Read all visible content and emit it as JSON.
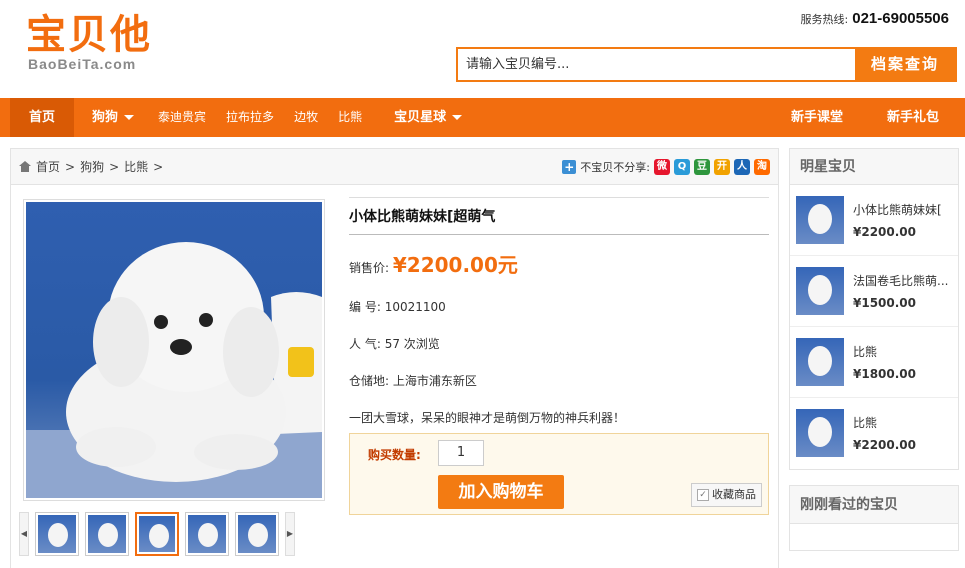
{
  "header": {
    "logo_main": "宝贝他",
    "logo_sub": "BaoBeiTa.com",
    "hotline_label": "服务热线:",
    "hotline_number": "021-69005506",
    "search_placeholder": "请输入宝贝编号...",
    "search_button": "档案查询"
  },
  "nav": {
    "items": [
      "首页",
      "狗狗",
      "泰迪贵宾",
      "拉布拉多",
      "边牧",
      "比熊",
      "宝贝星球"
    ],
    "right_items": [
      "新手课堂",
      "新手礼包"
    ]
  },
  "breadcrumb": [
    "首页",
    "狗狗",
    "比熊"
  ],
  "share": {
    "label": "不宝贝不分享:",
    "icons": [
      "weibo",
      "qzone",
      "douban",
      "kaixin",
      "renren",
      "taobao"
    ],
    "icon_glyphs": [
      "微",
      "Q",
      "豆",
      "开",
      "人",
      "淘"
    ],
    "icon_colors": [
      "#e6162d",
      "#2a9bd8",
      "#2e963d",
      "#f1a200",
      "#1d67b6",
      "#ff6a00"
    ]
  },
  "product": {
    "title": "小体比熊萌妹妹[超萌气",
    "price_label": "销售价:",
    "price": "¥2200.00元",
    "code_label": "编  号:",
    "code": "10021100",
    "views_label": "人  气:",
    "views": "57 次浏览",
    "location_label": "仓储地:",
    "location": "上海市浦东新区",
    "description": "一团大雪球，呆呆的眼神才是萌倒万物的神兵利器！",
    "qty_label": "购买数量:",
    "qty": "1",
    "cart_button": "加入购物车",
    "fav_button": "收藏商品"
  },
  "sidebar": {
    "title": "明星宝贝",
    "items": [
      {
        "name": "小体比熊萌妹妹[",
        "price": "¥2200.00"
      },
      {
        "name": "法国卷毛比熊萌...",
        "price": "¥1500.00"
      },
      {
        "name": "比熊",
        "price": "¥1800.00"
      },
      {
        "name": "比熊",
        "price": "¥2200.00"
      }
    ],
    "recent_title": "刚刚看过的宝贝"
  }
}
